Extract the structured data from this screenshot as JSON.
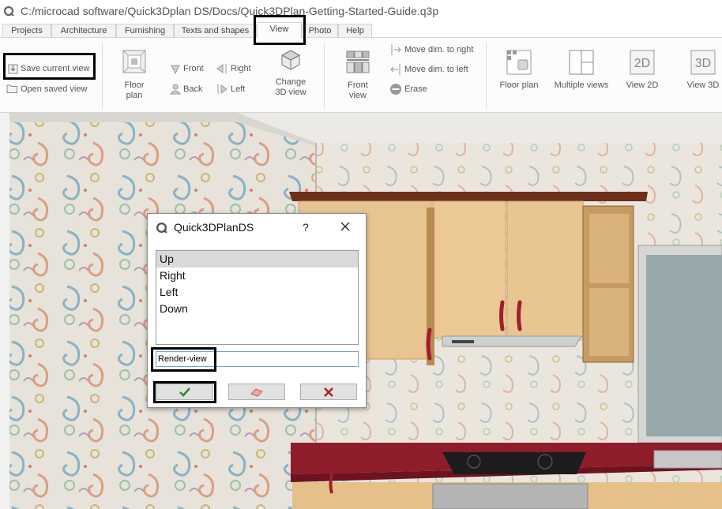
{
  "window": {
    "path": "C:/microcad software/Quick3Dplan DS/Docs/Quick3DPlan-Getting-Started-Guide.q3p"
  },
  "tabs": [
    {
      "label": "Projects"
    },
    {
      "label": "Architecture"
    },
    {
      "label": "Furnishing"
    },
    {
      "label": "Texts and shapes"
    },
    {
      "label": "View",
      "active": true
    },
    {
      "label": "Photo"
    },
    {
      "label": "Help"
    }
  ],
  "ribbon": {
    "save_current_view": "Save current view",
    "open_saved_view": "Open saved view",
    "floor_plan_small_l1": "Floor",
    "floor_plan_small_l2": "plan",
    "front": "Front",
    "back": "Back",
    "right": "Right",
    "left": "Left",
    "change_3d_view_l1": "Change",
    "change_3d_view_l2": "3D view",
    "front_view_l1": "Front",
    "front_view_l2": "view",
    "move_dim_right": "Move dim. to right",
    "move_dim_left": "Move dim. to left",
    "erase": "Erase",
    "floor_plan": "Floor plan",
    "multiple_views": "Multiple views",
    "view_2d": "View 2D",
    "view_3d": "View 3D",
    "icon_2d_text": "2D",
    "icon_3d_text": "3D"
  },
  "dialog": {
    "title": "Quick3DPlanDS",
    "help": "?",
    "items": [
      "Up",
      "Right",
      "Left",
      "Down"
    ],
    "selected_index": 0,
    "input_value": "Render-view"
  },
  "colors": {
    "accent": "#2a6ebb",
    "wallpaper": "#e6e1d8",
    "cabinet": "#e8c48f",
    "worktop": "#9a1e2d",
    "ok_check": "#2e8b2e",
    "cancel_x": "#b22020"
  }
}
